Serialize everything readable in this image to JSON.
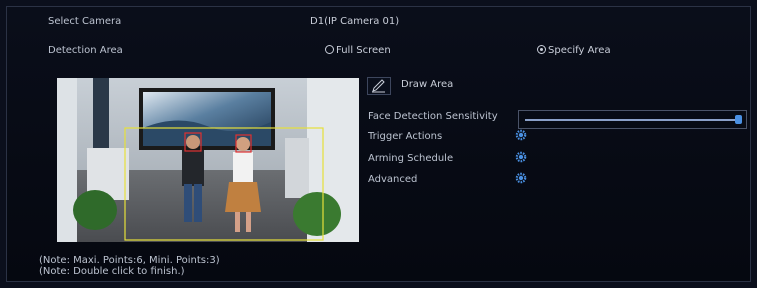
{
  "camera": {
    "label": "Select Camera",
    "value": "D1(IP Camera 01)"
  },
  "detection_area": {
    "label": "Detection Area",
    "option_full": "Full Screen",
    "option_specify": "Specify Area",
    "selected": "Specify Area"
  },
  "draw_area_label": "Draw Area",
  "settings": {
    "sensitivity_label": "Face Detection Sensitivity",
    "sensitivity_level": 1.0,
    "trigger_label": "Trigger Actions",
    "schedule_label": "Arming Schedule",
    "advanced_label": "Advanced"
  },
  "notes": {
    "points": "(Note: Maxi. Points:6, Mini. Points:3)",
    "finish": "(Note: Double click to finish.)"
  },
  "colors": {
    "accent": "#4a90e2",
    "detection_box": "#e6e03a",
    "face_box": "#e03030"
  },
  "icons": {
    "draw": "pencil-icon",
    "settings": "gear-icon"
  }
}
